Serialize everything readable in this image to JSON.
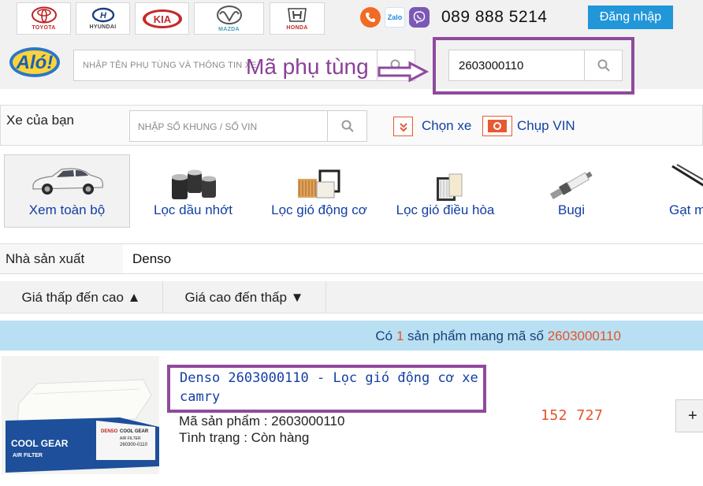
{
  "header": {
    "brands": [
      {
        "name": "TOYOTA",
        "logo_color": "#c02020"
      },
      {
        "name": "HYUNDAI",
        "logo_color": "#1b3f7f"
      },
      {
        "name": "KIA",
        "logo_color": "#c52a2a"
      },
      {
        "name": "MAZDA",
        "logo_color": "#444444"
      },
      {
        "name": "HONDA",
        "logo_color": "#444444"
      }
    ],
    "contact_icons": [
      "phone-icon",
      "zalo-icon",
      "viber-icon"
    ],
    "zalo_text": "Zalo",
    "phone": "089 888 5214",
    "login_label": "Đăng nhập"
  },
  "search": {
    "main_placeholder": "NHẬP TÊN PHỤ TÙNG VÀ THÔNG TIN XE",
    "part_value": "2603000110"
  },
  "annotation": {
    "label": "Mã phụ tùng",
    "color": "#8f4a9e"
  },
  "vehicle": {
    "label": "Xe của bạn",
    "vin_placeholder": "NHẬP SỐ KHUNG / SỐ VIN",
    "choose_label": "Chọn xe",
    "photo_label": "Chụp VIN"
  },
  "categories": [
    {
      "label": "Xem toàn bộ",
      "icon": "car-icon"
    },
    {
      "label": "Lọc dầu nhớt",
      "icon": "oil-filter-icon"
    },
    {
      "label": "Lọc gió động cơ",
      "icon": "air-filter-icon"
    },
    {
      "label": "Lọc gió điều hòa",
      "icon": "cabin-filter-icon"
    },
    {
      "label": "Bugi",
      "icon": "spark-plug-icon"
    },
    {
      "label": "Gạt m",
      "icon": "wiper-icon"
    }
  ],
  "manufacturer": {
    "label": "Nhà sản xuất",
    "value": "Denso"
  },
  "sort": {
    "asc_label": "Giá thấp đến cao ▲",
    "desc_label": "Giá cao đến thấp ▼"
  },
  "results": {
    "prefix": "Có",
    "count": "1",
    "middle": "sản phẩm mang mã số",
    "code": "2603000110"
  },
  "product": {
    "title": "Denso 2603000110 - Lọc gió động cơ xe camry",
    "sku_line": "Mã sản phẩm : 2603000110",
    "status_line": "Tình trạng : Còn hàng",
    "price": "152 727",
    "add_label": "+",
    "image_text": {
      "brand": "COOL GEAR",
      "type": "AIR FILTER",
      "mark": "DENSO",
      "part_no": "260300-0110"
    }
  },
  "colors": {
    "accent_blue": "#123fa3",
    "price_orange": "#e2532b",
    "banner_bg": "#b8e0f2",
    "login_bg": "#2196d9"
  }
}
